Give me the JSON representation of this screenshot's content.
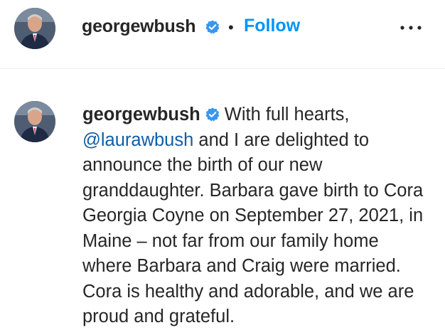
{
  "header": {
    "username": "georgewbush",
    "separator": "•",
    "follow_label": "Follow",
    "more_icon": "more-horizontal-icon"
  },
  "post": {
    "username": "georgewbush",
    "caption_start": "With full hearts,",
    "mention": "@laurawbush",
    "caption_rest": "and I are delighted to announce the birth of our new granddaughter. Barbara gave birth to Cora Georgia Coyne on September 27, 2021, in Maine – not far from our family home where Barbara and Craig were married. Cora is healthy and adorable, and we are proud and grateful."
  },
  "colors": {
    "follow_blue": "#0095f6",
    "mention_blue": "#0f5ea8",
    "verified_blue": "#3897f0",
    "text": "#262626",
    "divider": "#efefef"
  }
}
